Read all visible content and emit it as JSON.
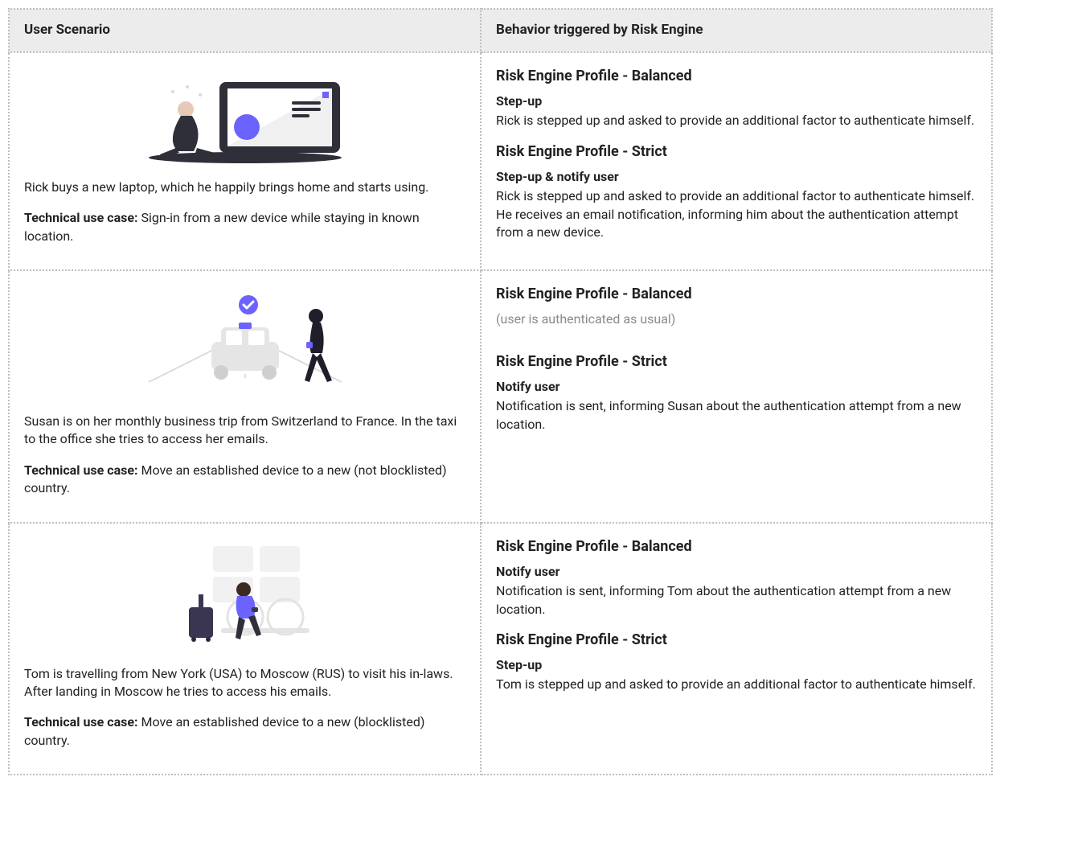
{
  "header": {
    "col1": "User Scenario",
    "col2": "Behavior triggered by Risk Engine"
  },
  "rows": [
    {
      "illustration": "laptop-user",
      "description": "Rick buys a new laptop, which he happily brings home and starts using.",
      "tech_label": "Technical use case:",
      "tech_value": "Sign-in from a new device while staying in known location.",
      "balanced_title": "Risk Engine Profile - Balanced",
      "balanced_action_label": "Step-up",
      "balanced_action_body": "Rick is stepped up and asked to provide an additional factor to authenticate himself.",
      "strict_title": "Risk Engine Profile - Strict",
      "strict_action_label": "Step-up & notify user",
      "strict_action_body": "Rick is stepped up and asked to provide an additional factor to authenticate himself.\nHe receives an email notification, informing him about the authentication attempt from a new device."
    },
    {
      "illustration": "taxi-walker",
      "description": "Susan is on her monthly business trip from Switzerland to France. In the taxi to the office she tries to access her emails.",
      "tech_label": "Technical use case:",
      "tech_value": "Move an established device to a new (not blocklisted) country.",
      "balanced_title": "Risk Engine Profile - Balanced",
      "balanced_muted": "(user is authenticated as usual)",
      "strict_title": "Risk Engine Profile - Strict",
      "strict_action_label": "Notify user",
      "strict_action_body": "Notification is sent, informing Susan about the authentication attempt from a new location."
    },
    {
      "illustration": "airport-traveler",
      "description": "Tom is travelling from New York (USA) to Moscow (RUS) to visit his in-laws. After landing in Moscow he tries to access his emails.",
      "tech_label": "Technical use case:",
      "tech_value": "Move an established device to a new (blocklisted) country.",
      "balanced_title": "Risk Engine Profile - Balanced",
      "balanced_action_label": "Notify user",
      "balanced_action_body": "Notification is sent, informing Tom about the authentication attempt from a new location.",
      "strict_title": "Risk Engine Profile - Strict",
      "strict_action_label": "Step-up",
      "strict_action_body": "Tom is stepped up and asked to provide an additional factor to authenticate himself."
    }
  ]
}
